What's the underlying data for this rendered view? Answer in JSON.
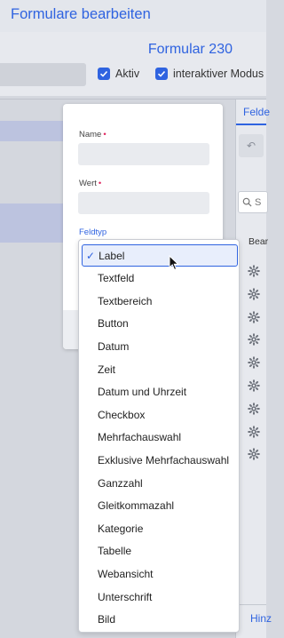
{
  "app": {
    "title": "Formulare bearbeiten"
  },
  "form": {
    "title": "Formular 230"
  },
  "toggles": {
    "aktiv": "Aktiv",
    "interaktiv": "interaktiver Modus"
  },
  "right_panel": {
    "tab": "Felde",
    "search": "S",
    "column": "Bear",
    "add": "Hinz"
  },
  "dialog": {
    "name_label": "Name",
    "value_label": "Wert",
    "required_mark": "•",
    "type_label": "Feldtyp"
  },
  "dropdown": {
    "selected": "Label",
    "options": [
      "Label",
      "Textfeld",
      "Textbereich",
      "Button",
      "Datum",
      "Zeit",
      "Datum und Uhrzeit",
      "Checkbox",
      "Mehrfachauswahl",
      "Exklusive Mehrfachauswahl",
      "Ganzzahl",
      "Gleitkommazahl",
      "Kategorie",
      "Tabelle",
      "Webansicht",
      "Unterschrift",
      "Bild"
    ]
  },
  "colors": {
    "accent": "#2f63e0",
    "required": "#e0245e"
  }
}
